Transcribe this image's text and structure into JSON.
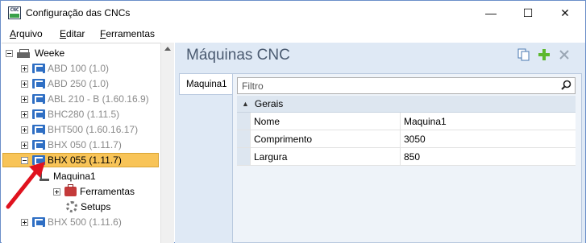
{
  "window": {
    "title": "Configuração das CNCs",
    "app_icon_text": "CNC",
    "minimize_glyph": "—",
    "maximize_glyph": "☐",
    "close_glyph": "✕"
  },
  "menu": {
    "items": [
      {
        "label": "Arquivo",
        "accel": "A"
      },
      {
        "label": "Editar",
        "accel": "E"
      },
      {
        "label": "Ferramentas",
        "accel": "F"
      }
    ]
  },
  "tree": {
    "root": {
      "label": "Weeke",
      "icon": "weeke-machine-icon"
    },
    "items": [
      {
        "label": "ABD 100 (1.0)"
      },
      {
        "label": "ABD 250 (1.0)"
      },
      {
        "label": "ABL 210 - B (1.60.16.9)"
      },
      {
        "label": "BHC280 (1.11.5)"
      },
      {
        "label": "BHT500 (1.60.16.17)"
      },
      {
        "label": "BHX 050 (1.11.7)"
      },
      {
        "label": "BHX 055 (1.11.7)",
        "selected": true
      },
      {
        "label": "BHX 500 (1.11.6)"
      }
    ],
    "children": [
      {
        "label": "Maquina1",
        "icon": "machine-icon"
      },
      {
        "label": "Ferramentas",
        "icon": "toolbox-icon"
      },
      {
        "label": "Setups",
        "icon": "gear-icon"
      }
    ]
  },
  "panel": {
    "title": "Máquinas CNC",
    "toolbar": {
      "copy_icon": "copy-icon",
      "add_icon": "plus-icon",
      "delete_icon": "close-icon"
    },
    "tab_label": "Maquina1",
    "filter_placeholder": "Filtro",
    "category": "Gerais",
    "properties": [
      {
        "name": "Nome",
        "value": "Maquina1"
      },
      {
        "name": "Comprimento",
        "value": "3050"
      },
      {
        "name": "Largura",
        "value": "850"
      }
    ]
  },
  "colors": {
    "selection": "#f8c458",
    "accent_arrow": "#e0121e",
    "bhx_icon": "#2f6fc4",
    "add_icon": "#5cb82e"
  }
}
